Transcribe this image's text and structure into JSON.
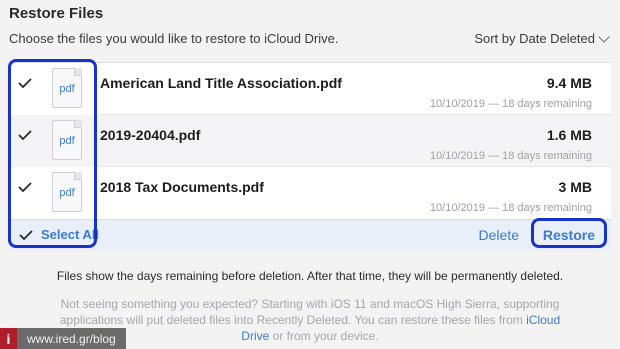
{
  "header": {
    "title": "Restore Files",
    "subtitle": "Choose the files you would like to restore to iCloud Drive.",
    "sort_label": "Sort by Date Deleted"
  },
  "files": [
    {
      "name": "American Land Title Association.pdf",
      "size": "9.4 MB",
      "meta": "10/10/2019 — 18 days remaining",
      "icon_label": "pdf",
      "checked": true
    },
    {
      "name": "2019-20404.pdf",
      "size": "1.6 MB",
      "meta": "10/10/2019 — 18 days remaining",
      "icon_label": "pdf",
      "checked": true
    },
    {
      "name": "2018 Tax Documents.pdf",
      "size": "3 MB",
      "meta": "10/10/2019 — 18 days remaining",
      "icon_label": "pdf",
      "checked": true
    }
  ],
  "footer": {
    "select_all": "Select All",
    "delete": "Delete",
    "restore": "Restore"
  },
  "notes": {
    "info": "Files show the days remaining before deletion. After that time, they will be permanently deleted.",
    "help_prefix": "Not seeing something you expected? Starting with iOS 11 and macOS High Sierra, supporting applications will put deleted files into Recently Deleted. You can restore these files from ",
    "help_link": "iCloud Drive",
    "help_suffix": " or from your device."
  },
  "watermark": {
    "badge": "i",
    "url": "www.ired.gr/blog"
  },
  "colors": {
    "accent": "#3b7bd4",
    "highlight": "#1733c9",
    "background": "#f3f3f4"
  },
  "icons": [
    "chevron-down-icon",
    "checkmark-icon",
    "pdf-file-icon"
  ]
}
